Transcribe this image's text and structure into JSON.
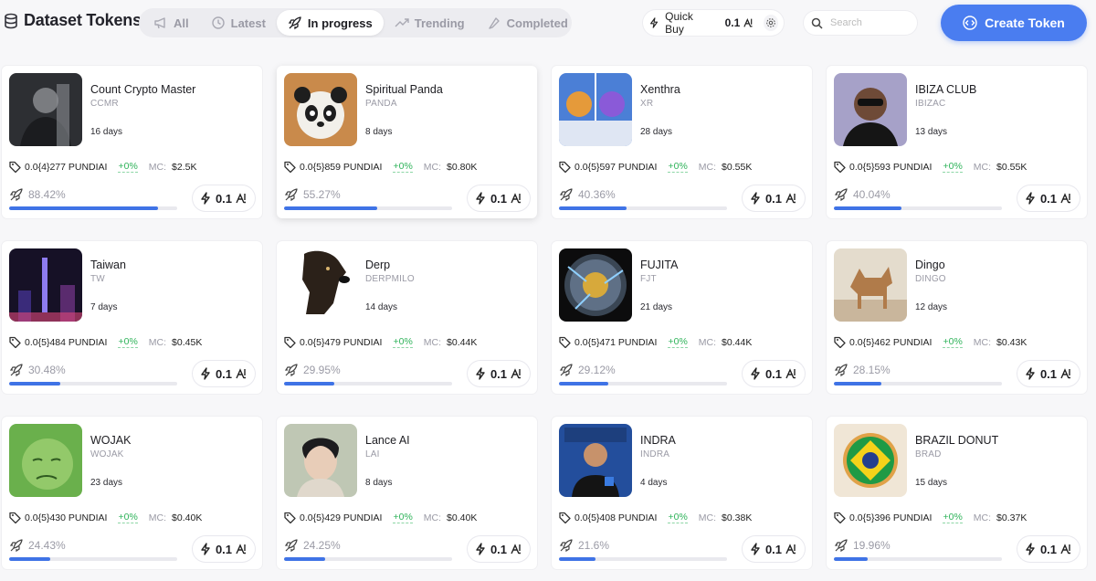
{
  "header": {
    "title": "Dataset Tokens",
    "tabs": [
      {
        "label": "All",
        "icon": "megaphone-icon",
        "active": false
      },
      {
        "label": "Latest",
        "icon": "clock-icon",
        "active": false
      },
      {
        "label": "In progress",
        "icon": "rocket-icon",
        "active": true
      },
      {
        "label": "Trending",
        "icon": "trend-icon",
        "active": false
      },
      {
        "label": "Completed",
        "icon": "flag-icon",
        "active": false
      }
    ],
    "quick_buy": {
      "label": "Quick Buy",
      "value": "0.1"
    },
    "search": {
      "placeholder": "Search"
    },
    "create_button": "Create Token"
  },
  "colors": {
    "accent": "#4a7df0",
    "positive": "#2fb35a",
    "progress": "#3f73e6"
  },
  "tokens": [
    {
      "name": "Count Crypto Master",
      "ticker": "CCMR",
      "age": "16 days",
      "price": "0.0{4}277 PUNDIAI",
      "change": "+0%",
      "mc_label": "MC:",
      "mc": "$2.5K",
      "progress_text": "88.42%",
      "progress": 0.8842,
      "buy": "0.1"
    },
    {
      "name": "Spiritual Panda",
      "ticker": "PANDA",
      "age": "8 days",
      "price": "0.0{5}859 PUNDIAI",
      "change": "+0%",
      "mc_label": "MC:",
      "mc": "$0.80K",
      "progress_text": "55.27%",
      "progress": 0.5527,
      "buy": "0.1"
    },
    {
      "name": "Xenthra",
      "ticker": "XR",
      "age": "28 days",
      "price": "0.0{5}597 PUNDIAI",
      "change": "+0%",
      "mc_label": "MC:",
      "mc": "$0.55K",
      "progress_text": "40.36%",
      "progress": 0.4036,
      "buy": "0.1"
    },
    {
      "name": "IBIZA CLUB",
      "ticker": "IBIZAC",
      "age": "13 days",
      "price": "0.0{5}593 PUNDIAI",
      "change": "+0%",
      "mc_label": "MC:",
      "mc": "$0.55K",
      "progress_text": "40.04%",
      "progress": 0.4004,
      "buy": "0.1"
    },
    {
      "name": "Taiwan",
      "ticker": "TW",
      "age": "7 days",
      "price": "0.0{5}484 PUNDIAI",
      "change": "+0%",
      "mc_label": "MC:",
      "mc": "$0.45K",
      "progress_text": "30.48%",
      "progress": 0.3048,
      "buy": "0.1"
    },
    {
      "name": "Derp",
      "ticker": "DERPMILO",
      "age": "14 days",
      "price": "0.0{5}479 PUNDIAI",
      "change": "+0%",
      "mc_label": "MC:",
      "mc": "$0.44K",
      "progress_text": "29.95%",
      "progress": 0.2995,
      "buy": "0.1"
    },
    {
      "name": "FUJITA",
      "ticker": "FJT",
      "age": "21 days",
      "price": "0.0{5}471 PUNDIAI",
      "change": "+0%",
      "mc_label": "MC:",
      "mc": "$0.44K",
      "progress_text": "29.12%",
      "progress": 0.2912,
      "buy": "0.1"
    },
    {
      "name": "Dingo",
      "ticker": "DINGO",
      "age": "12 days",
      "price": "0.0{5}462 PUNDIAI",
      "change": "+0%",
      "mc_label": "MC:",
      "mc": "$0.43K",
      "progress_text": "28.15%",
      "progress": 0.2815,
      "buy": "0.1"
    },
    {
      "name": "WOJAK",
      "ticker": "WOJAK",
      "age": "23 days",
      "price": "0.0{5}430 PUNDIAI",
      "change": "+0%",
      "mc_label": "MC:",
      "mc": "$0.40K",
      "progress_text": "24.43%",
      "progress": 0.2443,
      "buy": "0.1"
    },
    {
      "name": "Lance AI",
      "ticker": "LAI",
      "age": "8 days",
      "price": "0.0{5}429 PUNDIAI",
      "change": "+0%",
      "mc_label": "MC:",
      "mc": "$0.40K",
      "progress_text": "24.25%",
      "progress": 0.2425,
      "buy": "0.1"
    },
    {
      "name": "INDRA",
      "ticker": "INDRA",
      "age": "4 days",
      "price": "0.0{5}408 PUNDIAI",
      "change": "+0%",
      "mc_label": "MC:",
      "mc": "$0.38K",
      "progress_text": "21.6%",
      "progress": 0.216,
      "buy": "0.1"
    },
    {
      "name": "BRAZIL DONUT",
      "ticker": "BRAD",
      "age": "15 days",
      "price": "0.0{5}396 PUNDIAI",
      "change": "+0%",
      "mc_label": "MC:",
      "mc": "$0.37K",
      "progress_text": "19.96%",
      "progress": 0.1996,
      "buy": "0.1"
    }
  ]
}
